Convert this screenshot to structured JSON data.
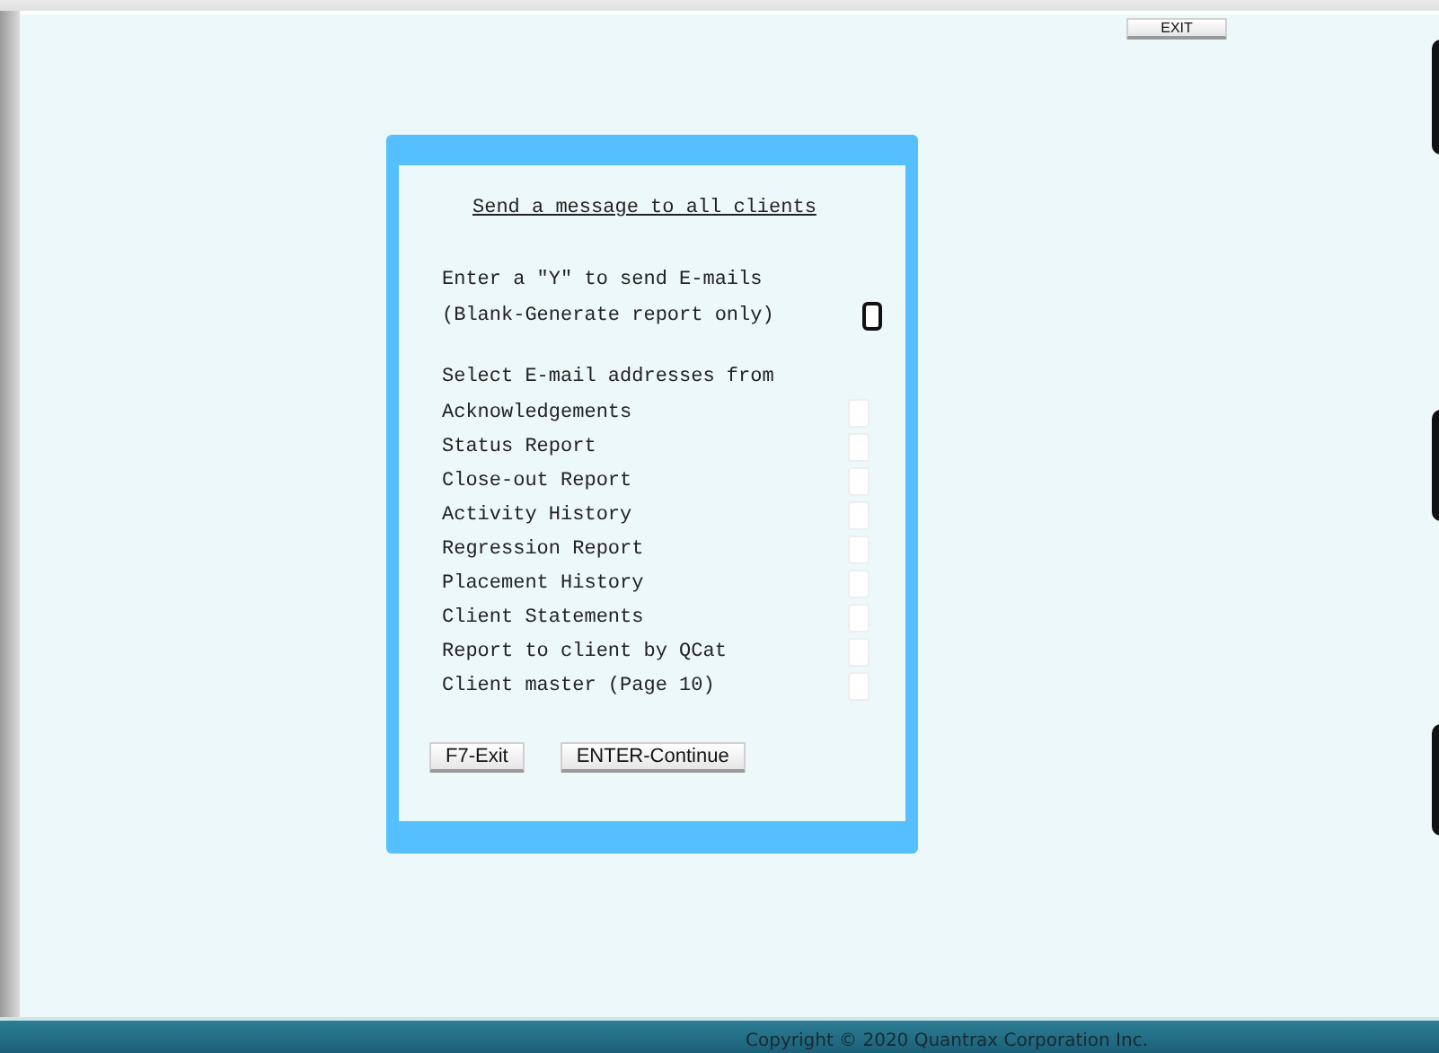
{
  "exit_button": "EXIT",
  "dialog": {
    "title": "Send a message to all clients",
    "prompt_lines": [
      "Enter a \"Y\" to send E-mails",
      "(Blank-Generate report only)"
    ],
    "select_label": "Select E-mail addresses from",
    "sources": [
      {
        "label": "Acknowledgements",
        "checked": false
      },
      {
        "label": "Status Report",
        "checked": false
      },
      {
        "label": "Close-out Report",
        "checked": false
      },
      {
        "label": "Activity History",
        "checked": false
      },
      {
        "label": "Regression Report",
        "checked": false
      },
      {
        "label": "Placement History",
        "checked": false
      },
      {
        "label": "Client Statements",
        "checked": false
      },
      {
        "label": "Report to client by QCat",
        "checked": false
      },
      {
        "label": "Client master (Page 10)",
        "checked": false
      }
    ],
    "buttons": [
      "F7-Exit",
      "ENTER-Continue"
    ]
  },
  "footer": {
    "copyright": "Copyright © 2020 Quantrax Corporation Inc."
  }
}
